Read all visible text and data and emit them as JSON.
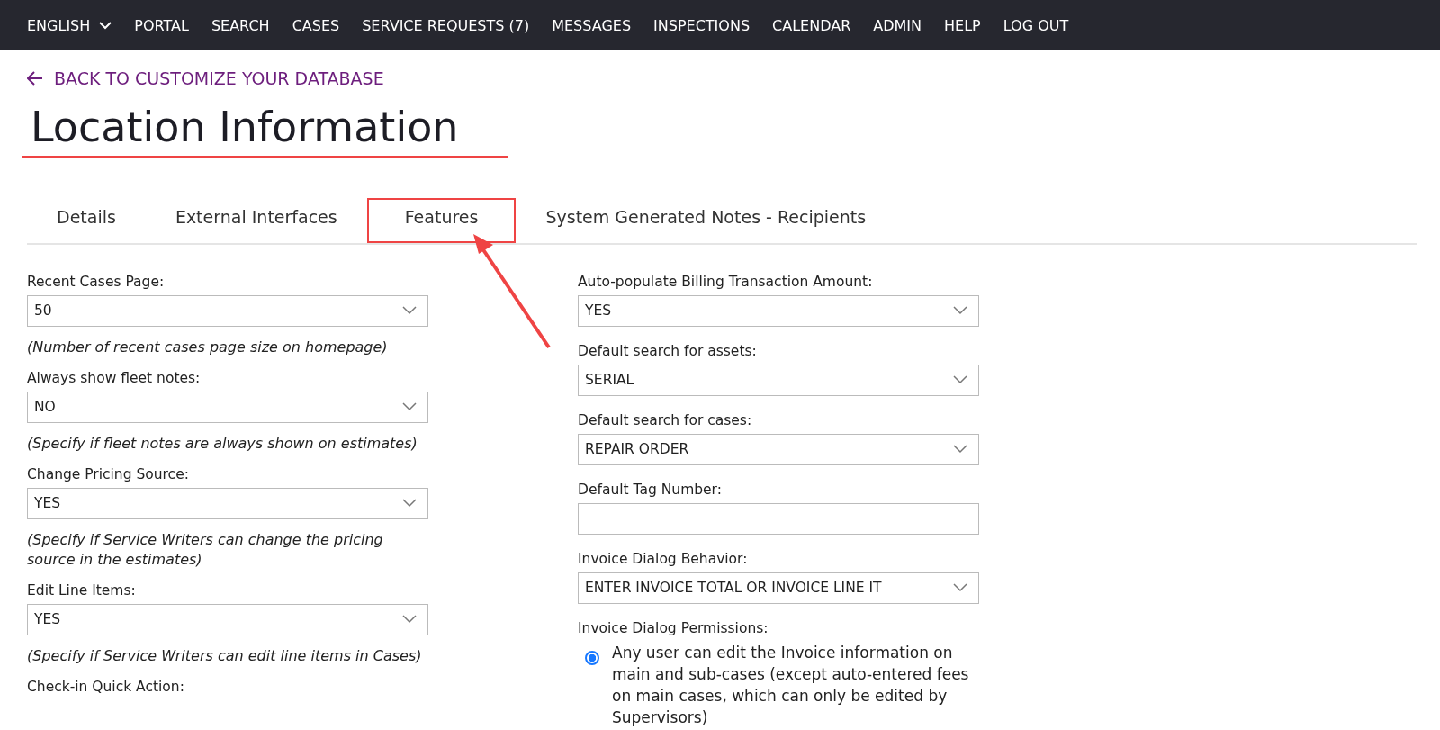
{
  "nav": {
    "language": "ENGLISH",
    "items": [
      "PORTAL",
      "SEARCH",
      "CASES",
      "SERVICE REQUESTS (7)",
      "MESSAGES",
      "INSPECTIONS",
      "CALENDAR",
      "ADMIN",
      "HELP",
      "LOG OUT"
    ]
  },
  "back_link": "BACK TO CUSTOMIZE YOUR DATABASE",
  "title": "Location Information",
  "tabs": [
    {
      "label": "Details",
      "selected": false
    },
    {
      "label": "External Interfaces",
      "selected": false
    },
    {
      "label": "Features",
      "selected": true
    },
    {
      "label": "System Generated Notes - Recipients",
      "selected": false
    }
  ],
  "left_fields": [
    {
      "kind": "select",
      "label": "Recent Cases Page:",
      "value": "50",
      "hint": "(Number of recent cases page size on homepage)"
    },
    {
      "kind": "select",
      "label": "Always show fleet notes:",
      "value": "NO",
      "hint": "(Specify if fleet notes are always shown on estimates)"
    },
    {
      "kind": "select",
      "label": "Change Pricing Source:",
      "value": "YES",
      "hint": "(Specify if Service Writers can change the pricing source in the estimates)"
    },
    {
      "kind": "select",
      "label": "Edit Line Items:",
      "value": "YES",
      "hint": "(Specify if Service Writers can edit line items in Cases)"
    },
    {
      "kind": "label",
      "label": "Check-in Quick Action:"
    }
  ],
  "right_fields": [
    {
      "kind": "select",
      "label": "Auto-populate Billing Transaction Amount:",
      "value": "YES"
    },
    {
      "kind": "select",
      "label": "Default search for assets:",
      "value": "SERIAL"
    },
    {
      "kind": "select",
      "label": "Default search for cases:",
      "value": "REPAIR ORDER"
    },
    {
      "kind": "text",
      "label": "Default Tag Number:"
    },
    {
      "kind": "select",
      "label": "Invoice Dialog Behavior:",
      "value": "ENTER INVOICE TOTAL OR INVOICE LINE IT"
    },
    {
      "kind": "radio",
      "label": "Invoice Dialog Permissions:",
      "options": [
        {
          "label": "Any user can edit the Invoice information on main and sub-cases (except auto-entered fees on main cases, which can only be edited by Supervisors)",
          "selected": true
        }
      ]
    }
  ]
}
